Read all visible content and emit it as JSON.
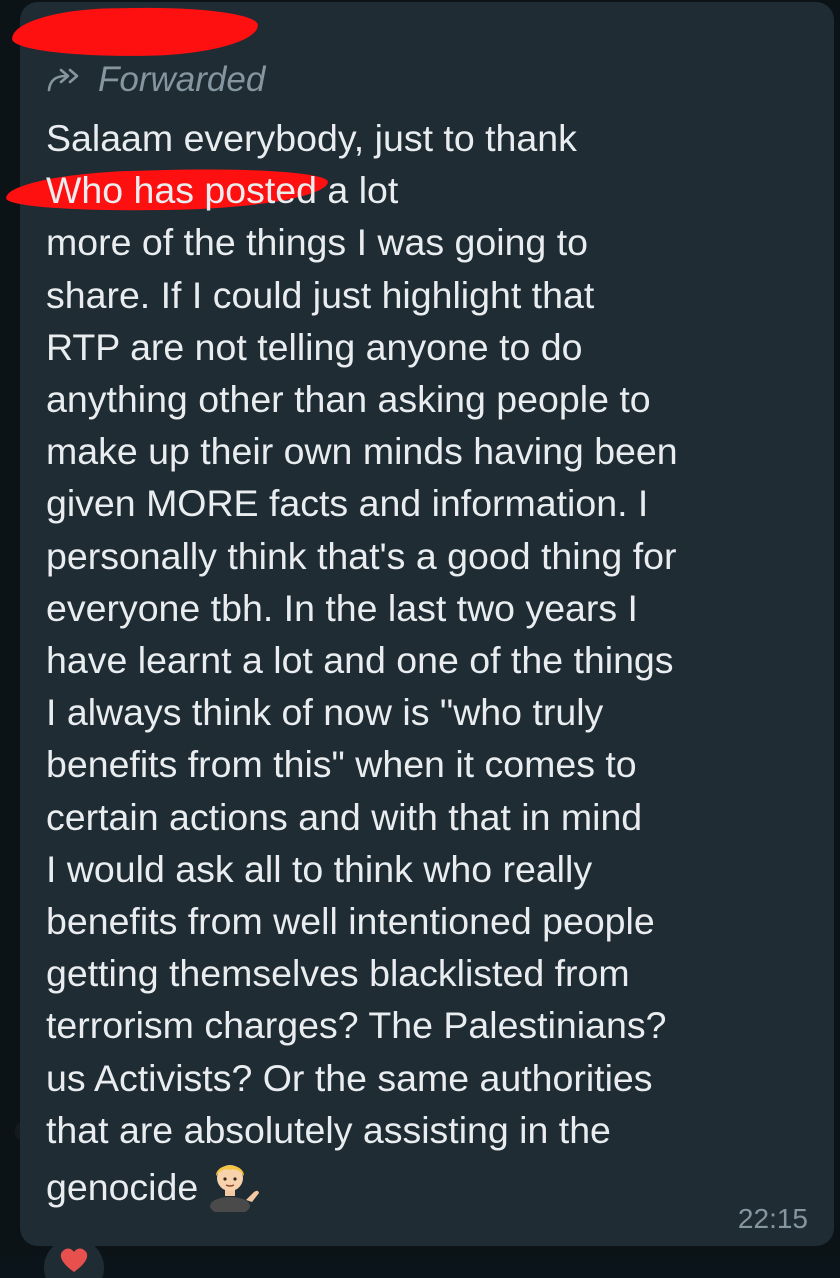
{
  "message": {
    "forwarded_label": "Forwarded",
    "text": "Salaam everybody, just to thank\n                              Who has posted a lot\nmore of the things I was going to\nshare.  If I could just highlight that\nRTP are not telling anyone to do\nanything other than asking people to\nmake up their own minds having been\ngiven MORE facts and information.  I\npersonally think that's a good thing for\neveryone tbh.  In the last two years I\nhave learnt a lot and one of the things\nI always think of now is \"who truly\nbenefits from this\" when it comes to\ncertain actions and with that in mind\nI would ask all to think who really\nbenefits from well intentioned people\ngetting themselves blacklisted from\nterrorism charges? The Palestinians?\nus Activists? Or the same authorities\nthat are absolutely assisting in the\ngenocide",
    "emoji": "person-tipping-hand-emoji",
    "time": "22:15"
  },
  "colors": {
    "background": "#0b141a",
    "bubble": "#1f2c34",
    "text": "#e9edef",
    "meta": "#8696a0",
    "redaction": "#ff1010"
  }
}
